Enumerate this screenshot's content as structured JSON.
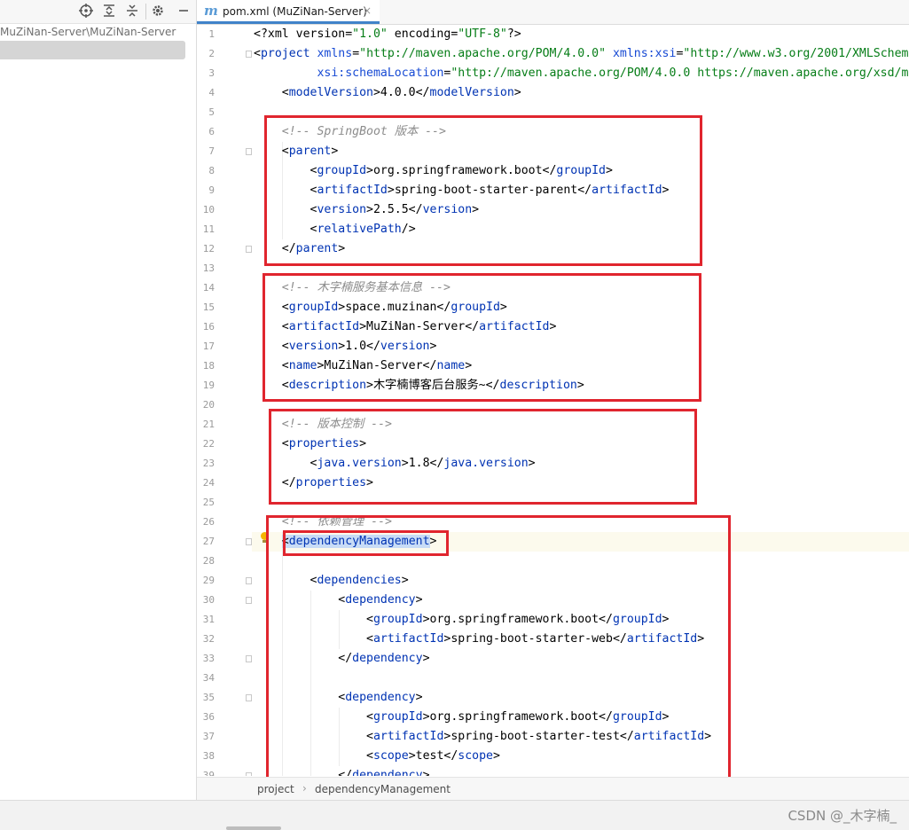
{
  "left_panel": {
    "toolbar_icons": [
      "target-icon",
      "expand-all-icon",
      "collapse-all-icon",
      "gear-icon",
      "minimize-icon"
    ],
    "path": "MuZiNan-Server\\MuZiNan-Server"
  },
  "tab": {
    "icon": "m",
    "label": "pom.xml (MuZiNan-Server)",
    "close": "×"
  },
  "lines": [
    {
      "num": "1",
      "html": "&lt;?xml version=<span class='str'>\"1.0\"</span> encoding=<span class='str'>\"UTF-8\"</span>?&gt;"
    },
    {
      "num": "2",
      "html": "&lt;<span class='tag'>project</span> <span class='attr'>xmlns</span>=<span class='str'>\"http://maven.apache.org/POM/4.0.0\"</span> <span class='attr'>xmlns:xsi</span>=<span class='str'>\"http://www.w3.org/2001/XMLSchem</span>"
    },
    {
      "num": "3",
      "html": "         <span class='attr'>xsi:schemaLocation</span>=<span class='str'>\"http://maven.apache.org/POM/4.0.0 https://maven.apache.org/xsd/m</span>"
    },
    {
      "num": "4",
      "html": "    &lt;<span class='tag'>modelVersion</span>&gt;4.0.0&lt;/<span class='tag'>modelVersion</span>&gt;"
    },
    {
      "num": "5",
      "html": ""
    },
    {
      "num": "6",
      "html": "    <span class='com'>&lt;!-- SpringBoot 版本 --&gt;</span>"
    },
    {
      "num": "7",
      "html": "    &lt;<span class='tag'>parent</span>&gt;"
    },
    {
      "num": "8",
      "html": "        &lt;<span class='tag'>groupId</span>&gt;org.springframework.boot&lt;/<span class='tag'>groupId</span>&gt;"
    },
    {
      "num": "9",
      "html": "        &lt;<span class='tag'>artifactId</span>&gt;spring-boot-starter-parent&lt;/<span class='tag'>artifactId</span>&gt;"
    },
    {
      "num": "10",
      "html": "        &lt;<span class='tag'>version</span>&gt;2.5.5&lt;/<span class='tag'>version</span>&gt;"
    },
    {
      "num": "11",
      "html": "        &lt;<span class='tag'>relativePath</span>/&gt;"
    },
    {
      "num": "12",
      "html": "    &lt;/<span class='tag'>parent</span>&gt;"
    },
    {
      "num": "13",
      "html": ""
    },
    {
      "num": "14",
      "html": "    <span class='com'>&lt;!-- 木字楠服务基本信息 --&gt;</span>"
    },
    {
      "num": "15",
      "html": "    &lt;<span class='tag'>groupId</span>&gt;space.muzinan&lt;/<span class='tag'>groupId</span>&gt;"
    },
    {
      "num": "16",
      "html": "    &lt;<span class='tag'>artifactId</span>&gt;MuZiNan-Server&lt;/<span class='tag'>artifactId</span>&gt;"
    },
    {
      "num": "17",
      "html": "    &lt;<span class='tag'>version</span>&gt;1.0&lt;/<span class='tag'>version</span>&gt;"
    },
    {
      "num": "18",
      "html": "    &lt;<span class='tag'>name</span>&gt;MuZiNan-Server&lt;/<span class='tag'>name</span>&gt;"
    },
    {
      "num": "19",
      "html": "    &lt;<span class='tag'>description</span>&gt;木字楠博客后台服务~&lt;/<span class='tag'>description</span>&gt;"
    },
    {
      "num": "20",
      "html": ""
    },
    {
      "num": "21",
      "html": "    <span class='com'>&lt;!-- 版本控制 --&gt;</span>"
    },
    {
      "num": "22",
      "html": "    &lt;<span class='tag'>properties</span>&gt;"
    },
    {
      "num": "23",
      "html": "        &lt;<span class='tag'>java.version</span>&gt;1.8&lt;/<span class='tag'>java.version</span>&gt;"
    },
    {
      "num": "24",
      "html": "    &lt;/<span class='tag'>properties</span>&gt;"
    },
    {
      "num": "25",
      "html": ""
    },
    {
      "num": "26",
      "html": "    <span class='com'>&lt;!-- 依赖管理 --&gt;</span>"
    },
    {
      "num": "27",
      "html": "    <span class='hl'>&lt;<span class='tag'>dependencyManagement</span></span>&gt;"
    },
    {
      "num": "28",
      "html": ""
    },
    {
      "num": "29",
      "html": "        &lt;<span class='tag'>dependencies</span>&gt;"
    },
    {
      "num": "30",
      "html": "            &lt;<span class='tag'>dependency</span>&gt;"
    },
    {
      "num": "31",
      "html": "                &lt;<span class='tag'>groupId</span>&gt;org.springframework.boot&lt;/<span class='tag'>groupId</span>&gt;"
    },
    {
      "num": "32",
      "html": "                &lt;<span class='tag'>artifactId</span>&gt;spring-boot-starter-web&lt;/<span class='tag'>artifactId</span>&gt;"
    },
    {
      "num": "33",
      "html": "            &lt;/<span class='tag'>dependency</span>&gt;"
    },
    {
      "num": "34",
      "html": ""
    },
    {
      "num": "35",
      "html": "            &lt;<span class='tag'>dependency</span>&gt;"
    },
    {
      "num": "36",
      "html": "                &lt;<span class='tag'>groupId</span>&gt;org.springframework.boot&lt;/<span class='tag'>groupId</span>&gt;"
    },
    {
      "num": "37",
      "html": "                &lt;<span class='tag'>artifactId</span>&gt;spring-boot-starter-test&lt;/<span class='tag'>artifactId</span>&gt;"
    },
    {
      "num": "38",
      "html": "                &lt;<span class='tag'>scope</span>&gt;test&lt;/<span class='tag'>scope</span>&gt;"
    },
    {
      "num": "39",
      "html": "            &lt;/<span class='tag'>dependency</span>&gt;"
    }
  ],
  "fold_lines": [
    "2",
    "7",
    "12",
    "27",
    "29",
    "30",
    "33",
    "35",
    "39"
  ],
  "current_line": "27",
  "breadcrumb": [
    "project",
    "dependencyManagement"
  ],
  "watermark": "CSDN @_木字楠_",
  "colors": {
    "tag": "#0033b3",
    "string": "#067d17",
    "comment": "#8c8c8c",
    "annotation_box": "#e0252e",
    "tab_underline": "#4083c9"
  }
}
